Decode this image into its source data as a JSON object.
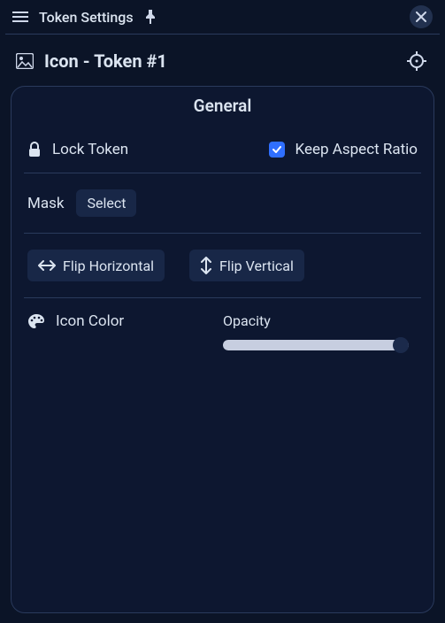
{
  "window": {
    "title": "Token Settings"
  },
  "header": {
    "title": "Icon - Token #1"
  },
  "panel": {
    "title": "General",
    "lock_label": "Lock Token",
    "keep_aspect_label": "Keep Aspect Ratio",
    "keep_aspect_checked": true,
    "mask_label": "Mask",
    "mask_select": "Select",
    "flip_h": "Flip Horizontal",
    "flip_v": "Flip Vertical",
    "icon_color": "Icon Color",
    "opacity_label": "Opacity",
    "opacity_value": 100
  }
}
